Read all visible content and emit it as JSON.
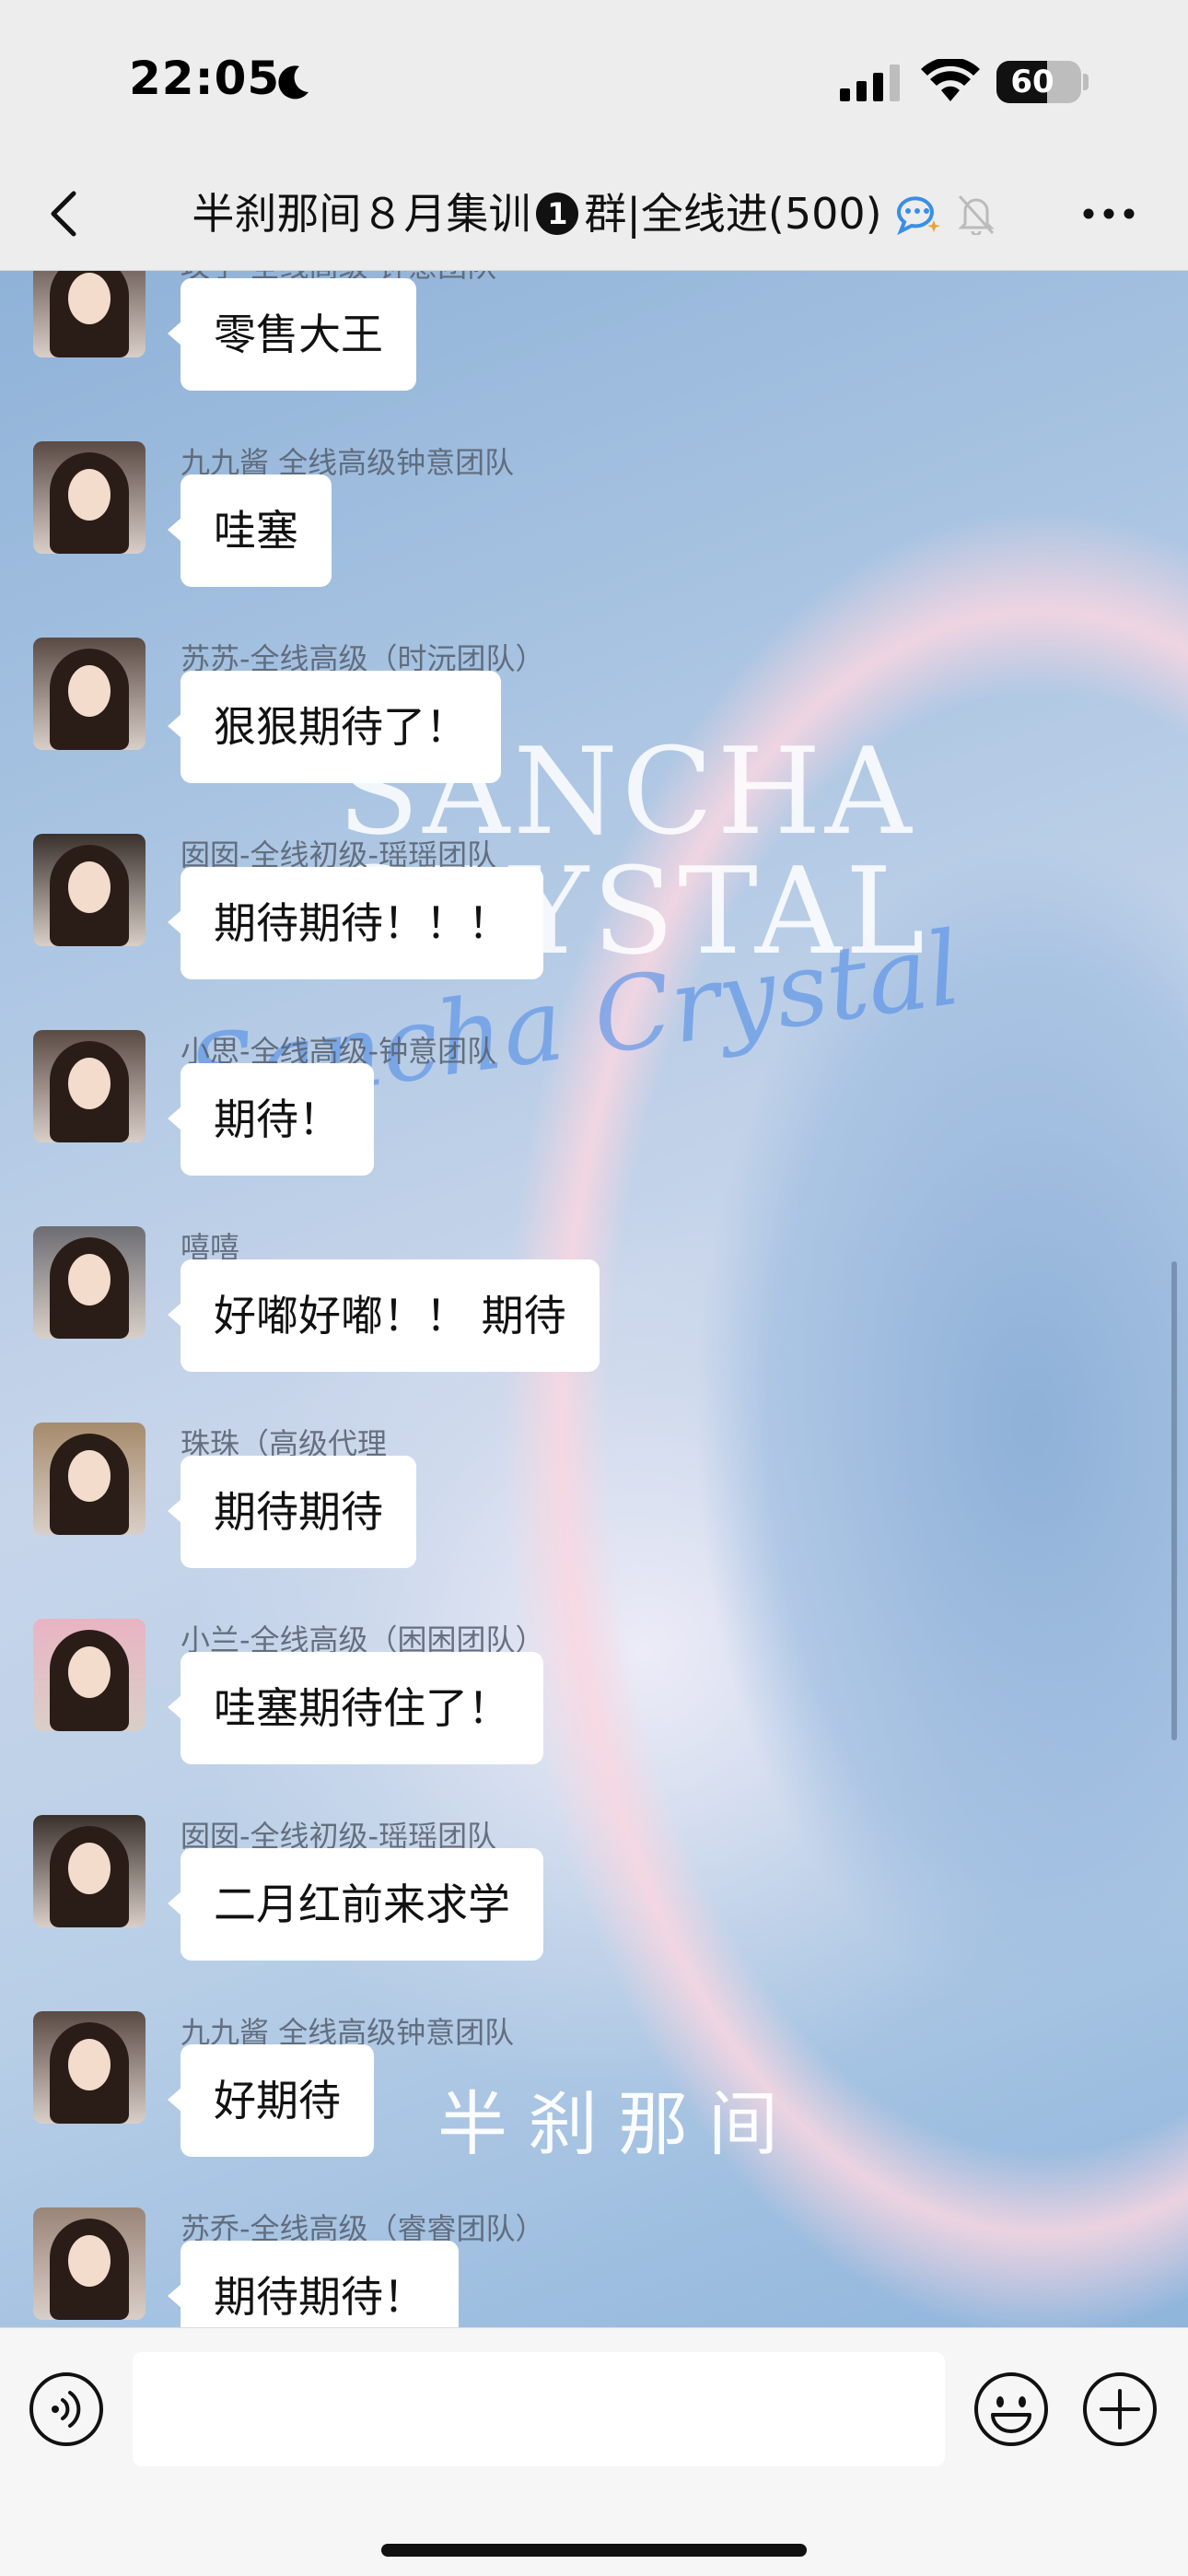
{
  "status_bar": {
    "time": "22:05",
    "battery": "60",
    "battery_level": 0.6
  },
  "header": {
    "title_part1": "半刹那间８月集训",
    "title_num": "1",
    "title_part2": "群|全线进(500)"
  },
  "watermark": {
    "english": "SANCHA\nCRYSTAL",
    "script": "Sancha Crystal",
    "chinese": "半刹那间"
  },
  "messages": [
    {
      "sender": "玫子-全线高级-钟意团队",
      "text": "零售大王",
      "avatar_color": "#5a4a44"
    },
    {
      "sender": "九九酱 全线高级钟意团队",
      "text": "哇塞",
      "avatar_color": "#5a4a44"
    },
    {
      "sender": "苏苏-全线高级（时沅团队）",
      "text": "狠狠期待了！",
      "avatar_color": "#5a4a44"
    },
    {
      "sender": "囡囡-全线初级-瑶瑶团队",
      "text": "期待期待！！！",
      "avatar_color": "#3a302c"
    },
    {
      "sender": "小思-全线高级-钟意团队",
      "text": "期待！",
      "avatar_color": "#5a4a44"
    },
    {
      "sender": "嘻嘻",
      "text": "好嘟好嘟！！ 期待",
      "avatar_color": "#6d6d72"
    },
    {
      "sender": "珠珠（高级代理",
      "text": "期待期待",
      "avatar_color": "#a68b6c"
    },
    {
      "sender": "小兰-全线高级（困困团队）",
      "text": "哇塞期待住了！",
      "avatar_color": "#e9b4c2"
    },
    {
      "sender": "囡囡-全线初级-瑶瑶团队",
      "text": "二月红前来求学",
      "avatar_color": "#3a302c"
    },
    {
      "sender": "九九酱 全线高级钟意团队",
      "text": "好期待",
      "avatar_color": "#5a4a44"
    },
    {
      "sender": "苏乔-全线高级（睿睿团队）",
      "text": "期待期待！",
      "avatar_color": "#9a8478"
    }
  ],
  "input": {
    "placeholder": ""
  }
}
